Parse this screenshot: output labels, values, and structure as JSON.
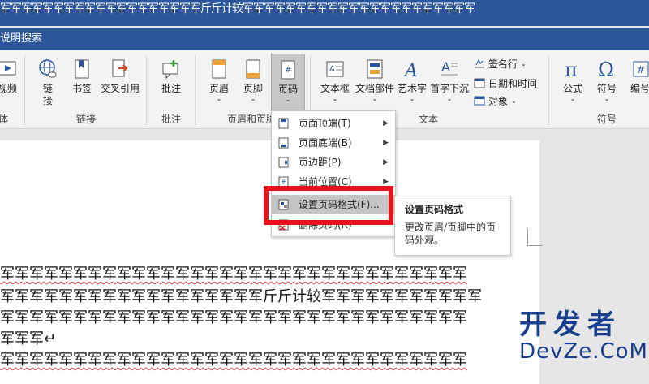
{
  "titlebar": {
    "text": "军军军军军军军军军军军军军军军军军军军斤斤计较军军军军军军军军军军军军军军军军军军军军军军"
  },
  "tellme": {
    "text": "说明搜索"
  },
  "ribbon": {
    "buttons": {
      "video": "视频",
      "link": "链\n接",
      "bookmark": "书签",
      "crossref": "交叉引用",
      "comment": "批注",
      "header": "页眉",
      "footer": "页脚",
      "pagenum": "页码",
      "textbox": "文本框",
      "quickparts": "文档部件",
      "wordart": "艺术字",
      "dropcap": "首字下沉",
      "equation": "公式",
      "symbol": "符号",
      "number": "编号"
    },
    "small": {
      "signature": "签名行",
      "datetime": "日期和时间",
      "object": "对象"
    },
    "groups": {
      "media": "体",
      "links": "链接",
      "comments": "批注",
      "headerfooter": "页眉和页脚",
      "text": "文本",
      "symbols": "符号"
    }
  },
  "menu": {
    "items": [
      {
        "label": "页面顶端(T)",
        "arrow": "▶"
      },
      {
        "label": "页面底端(B)",
        "arrow": "▶"
      },
      {
        "label": "页边距(P)",
        "arrow": "▶"
      },
      {
        "label": "当前位置(C)",
        "arrow": "▶"
      },
      {
        "label": "设置页码格式(F)...",
        "arrow": ""
      },
      {
        "label": "删除页码(R)",
        "arrow": ""
      }
    ]
  },
  "tooltip": {
    "title": "设置页码格式",
    "desc": "更改页眉/页脚中的页码外观。"
  },
  "document": {
    "lines": [
      "军军军军军军军军军军军军军军军军军军军军军军军军军军军军军军军军",
      "军军军军军军军军军军军军军军军军军军斤斤计较军军军军军军军军军军军",
      "军军军军军军军军军军军军军军军军军军军军军军军军军军军军军军军军",
      "军军军↵",
      "军军军军军军军军军军军军军军军军军军军军军军军军军军军军军军军军"
    ]
  },
  "watermark": {
    "line1": "开发者",
    "line2": "DevZe.CoM"
  },
  "colors": {
    "accent": "#2b579a",
    "highlight": "#e3141c",
    "watermark": "#1a3f8f"
  }
}
